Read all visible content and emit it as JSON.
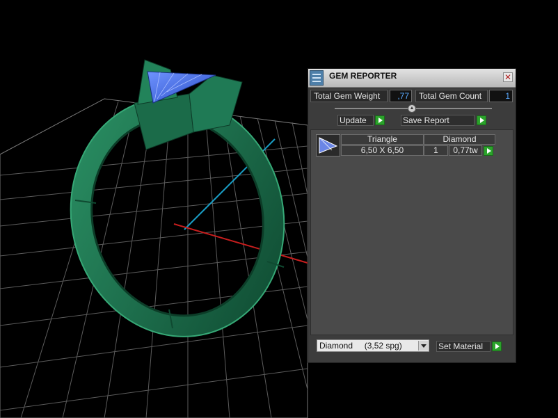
{
  "panel": {
    "title": "GEM REPORTER",
    "close_glyph": "✕",
    "total_gem_weight_label": "Total Gem Weight",
    "total_gem_weight_value": ",77",
    "total_gem_count_label": "Total Gem Count",
    "total_gem_count_value": "1",
    "update_label": "Update",
    "save_report_label": "Save Report",
    "gems": [
      {
        "shape": "Triangle",
        "material": "Diamond",
        "size": "6,50 X 6,50",
        "count": "1",
        "weight": "0,77tw"
      }
    ],
    "material_select": "Diamond     (3,52 spg)",
    "set_material_label": "Set Material"
  },
  "icons": {
    "title_icon": "gem-reporter-icon",
    "close": "close-icon",
    "slider": "slider-knob-icon",
    "play": "play-arrow-icon",
    "gem_thumbnail": "triangle-gem-icon",
    "dropdown": "chevron-down-icon"
  },
  "colors": {
    "ring": "#1f7a55",
    "gem": "#3a67d8",
    "accent_green": "#2ba32b",
    "value_blue": "#5aa9ff",
    "x_axis": "#c81e1e",
    "y_axis": "#1aa0c8"
  }
}
